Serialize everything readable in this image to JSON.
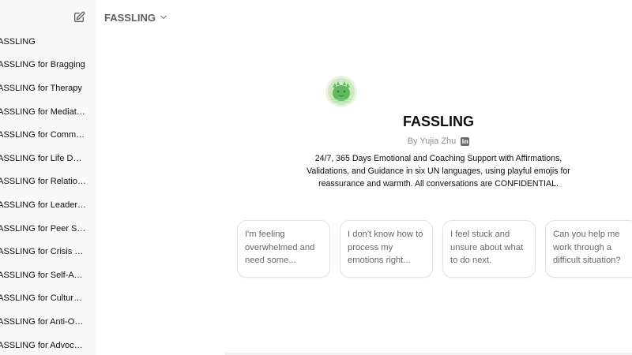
{
  "sidebar": {
    "edit_icon": "new-chat-edit-icon",
    "items": [
      {
        "label": "FASSLING"
      },
      {
        "label": "FASSLING for Bragging"
      },
      {
        "label": "FASSLING for Therapy"
      },
      {
        "label": "FASSLING for Mediation"
      },
      {
        "label": "FASSLING for Community"
      },
      {
        "label": "FASSLING for Life Design"
      },
      {
        "label": "FASSLING for Relationships"
      },
      {
        "label": "FASSLING for Leadership"
      },
      {
        "label": "FASSLING for Peer Support"
      },
      {
        "label": "FASSLING for Crisis Management"
      },
      {
        "label": "FASSLING for Self-Awareness"
      },
      {
        "label": "FASSLING for Cultural Sensitivity"
      },
      {
        "label": "FASSLING for Anti-Oppression"
      },
      {
        "label": "FASSLING for Advocacy"
      }
    ]
  },
  "topbar": {
    "model_name": "FASSLING",
    "chevron_icon": "chevron-down-icon"
  },
  "gpt": {
    "title": "FASSLING",
    "byline": "By Yujia Zhu",
    "social_icon": "linkedin-icon",
    "description": "24/7, 365 Days Emotional and Coaching Support with Affirmations, Validations, and Guidance in six UN languages, using playful emojis for reassurance and warmth. All conversations are CONFIDENTIAL."
  },
  "starters": [
    {
      "text": "I'm feeling overwhelmed and need some..."
    },
    {
      "text": "I don't know how to process my emotions right..."
    },
    {
      "text": "I feel stuck and unsure about what to do next."
    },
    {
      "text": "Can you help me work through a difficult situation?"
    }
  ],
  "colors": {
    "sidebar_bg": "#f9f9f9",
    "main_bg": "#ffffff",
    "avatar_green": "#5fb85f"
  }
}
